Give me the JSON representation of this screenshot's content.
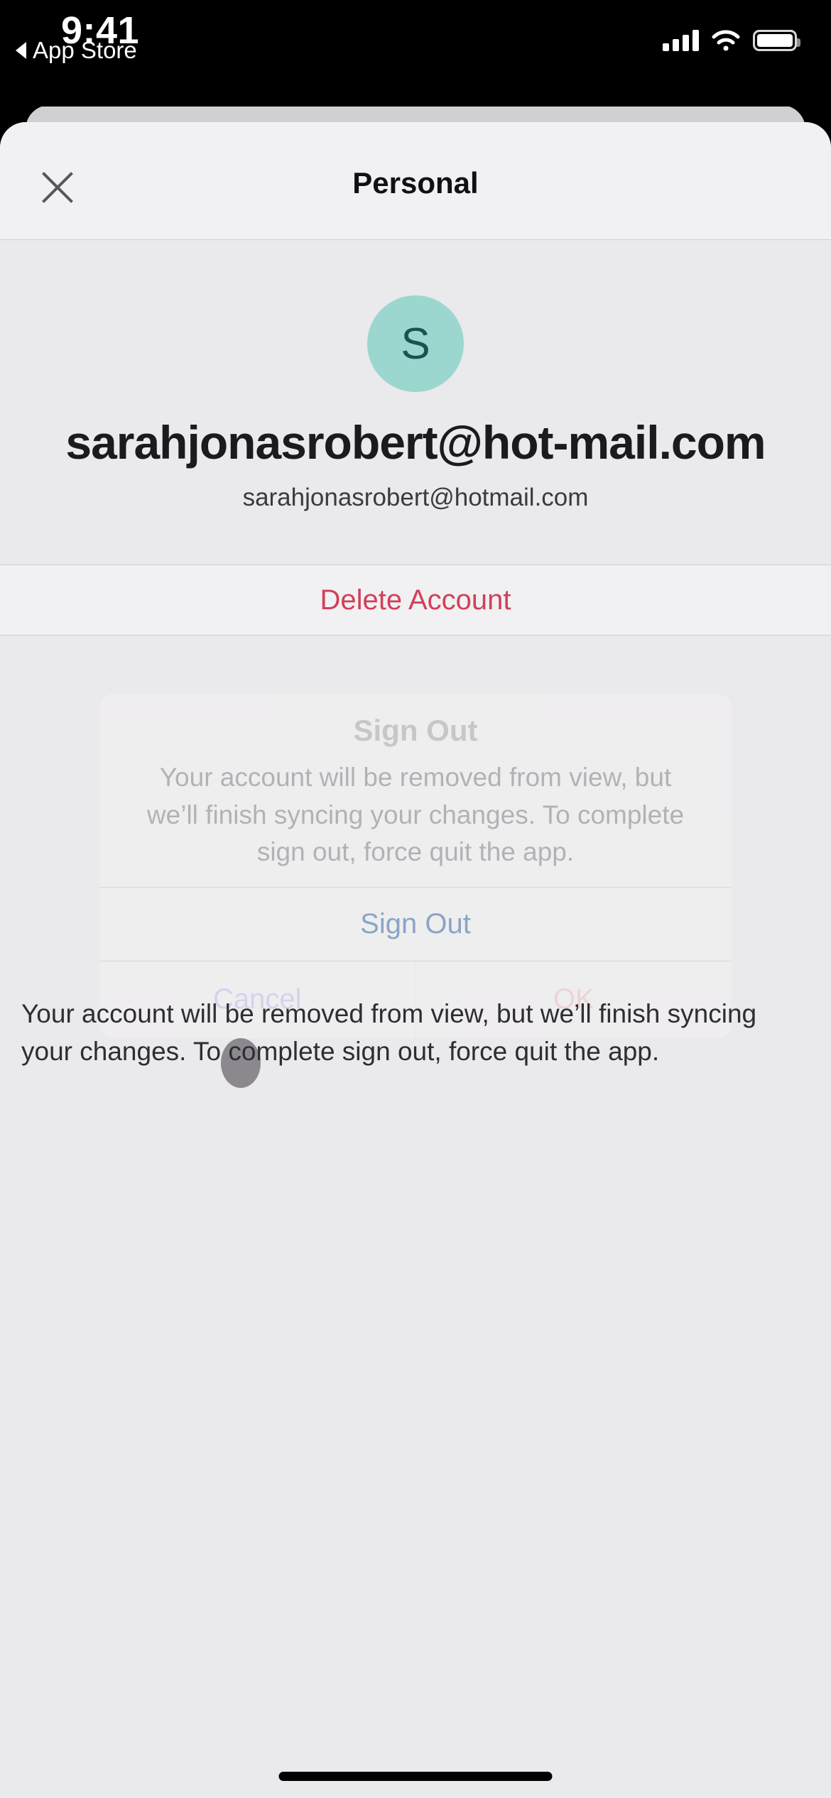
{
  "status_bar": {
    "time": "9:41",
    "back_label": "App Store",
    "back_icon": "triangle-left-icon",
    "signal_icon": "cellular-signal-icon",
    "wifi_icon": "wifi-icon",
    "battery_icon": "battery-icon"
  },
  "nav": {
    "title": "Personal",
    "close_icon": "close-x-icon"
  },
  "profile": {
    "avatar_initial": "S",
    "avatar_bg": "#9bd7cf",
    "avatar_fg": "#17554f",
    "account_title": "sarahjonasrobert@hot-mail.com",
    "account_email": "sarahjonasrobert@hotmail.com"
  },
  "rows": [
    {
      "label": "Delete Account",
      "style": "destructive",
      "color": "#d1405a"
    }
  ],
  "note": {
    "text": "Your account will be removed from view, but we’ll finish syncing your changes. To complete sign out, force quit the app."
  },
  "alert": {
    "title": "Sign Out",
    "message": "Your account will be removed from view, but we’ll finish syncing your changes. To complete sign out, force quit the app.",
    "primary_action": "Sign Out",
    "cancel_label": "Cancel",
    "ok_label": "OK",
    "accent_color": "#3d6fa8"
  }
}
